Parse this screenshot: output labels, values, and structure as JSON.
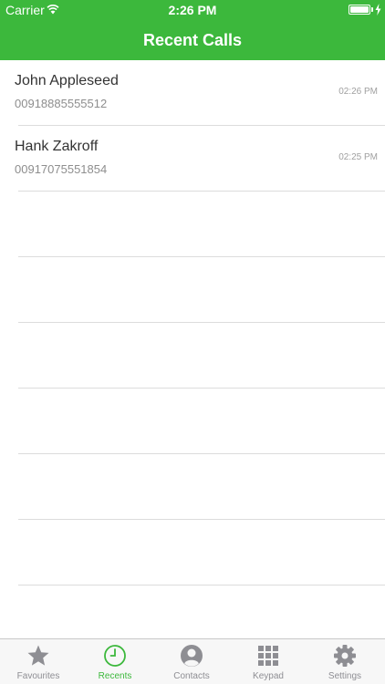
{
  "status_bar": {
    "carrier": "Carrier",
    "time": "2:26 PM",
    "wifi_icon": "wifi-icon",
    "battery_icon": "battery-icon",
    "charging_icon": "bolt-icon"
  },
  "nav": {
    "title": "Recent Calls"
  },
  "colors": {
    "accent": "#3cb83c",
    "separator": "#dcdcdc",
    "tab_inactive": "#8e8e93"
  },
  "calls": [
    {
      "name": "John Appleseed",
      "number": "00918885555512",
      "time": "02:26 PM"
    },
    {
      "name": "Hank Zakroff",
      "number": "00917075551854",
      "time": "02:25 PM"
    },
    {
      "name": "",
      "number": "",
      "time": ""
    },
    {
      "name": "",
      "number": "",
      "time": ""
    },
    {
      "name": "",
      "number": "",
      "time": ""
    },
    {
      "name": "",
      "number": "",
      "time": ""
    },
    {
      "name": "",
      "number": "",
      "time": ""
    },
    {
      "name": "",
      "number": "",
      "time": ""
    },
    {
      "name": "",
      "number": "",
      "time": ""
    }
  ],
  "tabs": [
    {
      "label": "Favourites",
      "icon": "star-icon",
      "active": false
    },
    {
      "label": "Recents",
      "icon": "clock-icon",
      "active": true
    },
    {
      "label": "Contacts",
      "icon": "person-icon",
      "active": false
    },
    {
      "label": "Keypad",
      "icon": "keypad-icon",
      "active": false
    },
    {
      "label": "Settings",
      "icon": "gear-icon",
      "active": false
    }
  ]
}
